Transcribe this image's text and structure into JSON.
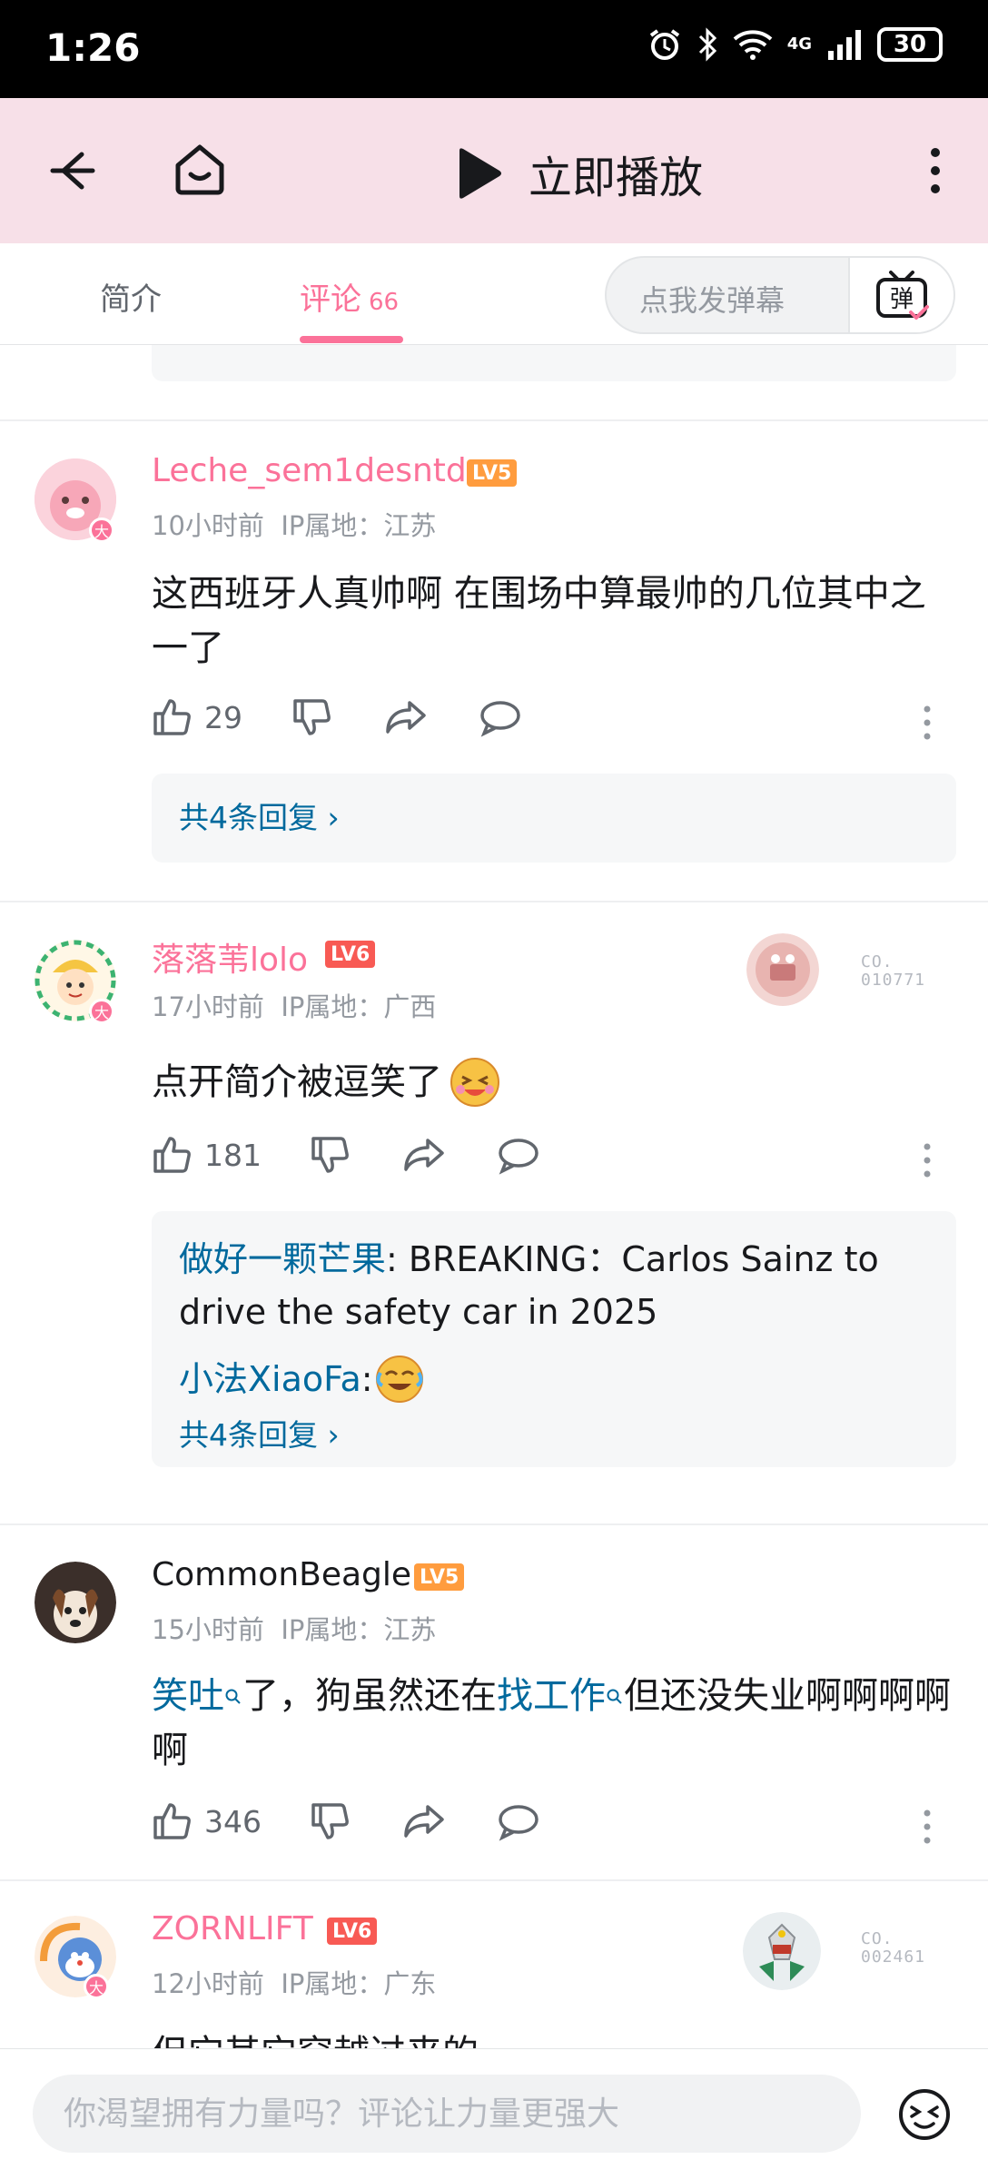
{
  "status_bar": {
    "time": "1:26",
    "network": "4G",
    "battery": "30"
  },
  "nav": {
    "play_label": "立即播放"
  },
  "tabs": {
    "intro": "简介",
    "comments": "评论",
    "comments_count": "66",
    "danmaku_placeholder": "点我发弹幕",
    "danmaku_icon_char": "弹"
  },
  "colors": {
    "accent": "#fb7299",
    "link": "#00699d",
    "nav_bg": "#f7e0e8"
  },
  "comments": [
    {
      "username": "Leche_sem1desntd",
      "level": "LV5",
      "time": "10小时前",
      "ip": "IP属地：江苏",
      "text": "这西班牙人真帅啊 在围场中算最帅的几位其中之一了",
      "likes": "29",
      "more_replies": "共4条回复 ›"
    },
    {
      "username": "落落苇lolo",
      "level": "LV6",
      "time": "17小时前",
      "ip": "IP属地：广西",
      "text": "点开简介被逗笑了",
      "likes": "181",
      "fan_number": "010771",
      "fan_prefix": "CO.",
      "sub_replies": [
        {
          "author": "做好一颗芒果",
          "text": ": BREAKING：Carlos Sainz to drive the safety car in 2025"
        },
        {
          "author": "小法XiaoFa",
          "text": ": "
        }
      ],
      "more_replies": "共4条回复 ›"
    },
    {
      "username": "CommonBeagle",
      "level": "LV5",
      "time": "15小时前",
      "ip": "IP属地：江苏",
      "text_parts": [
        "笑吐",
        "了，狗虽然还在",
        "找工作",
        "但还没失业啊啊啊啊啊"
      ],
      "likes": "346"
    },
    {
      "username": "ZORNLIFT",
      "level": "LV6",
      "time": "12小时前",
      "ip": "IP属地：广东",
      "text": "但它其它穿越过来的",
      "fan_number": "002461",
      "fan_prefix": "CO."
    }
  ],
  "avatar_badge": "大",
  "bottom": {
    "input_placeholder": "你渴望拥有力量吗？评论让力量更强大"
  }
}
